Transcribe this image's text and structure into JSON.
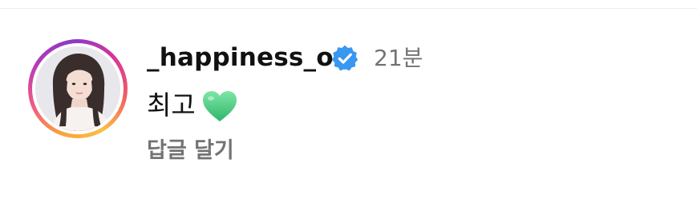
{
  "comment": {
    "username": "_happiness_o",
    "verified": true,
    "time": "21분",
    "text": "최고",
    "emoji": "green-heart-icon",
    "reply_label": "답글 달기"
  },
  "colors": {
    "verified_badge": "#3897f0",
    "heart": "#4fd18a",
    "meta_text": "#737373",
    "primary_text": "#111111"
  }
}
